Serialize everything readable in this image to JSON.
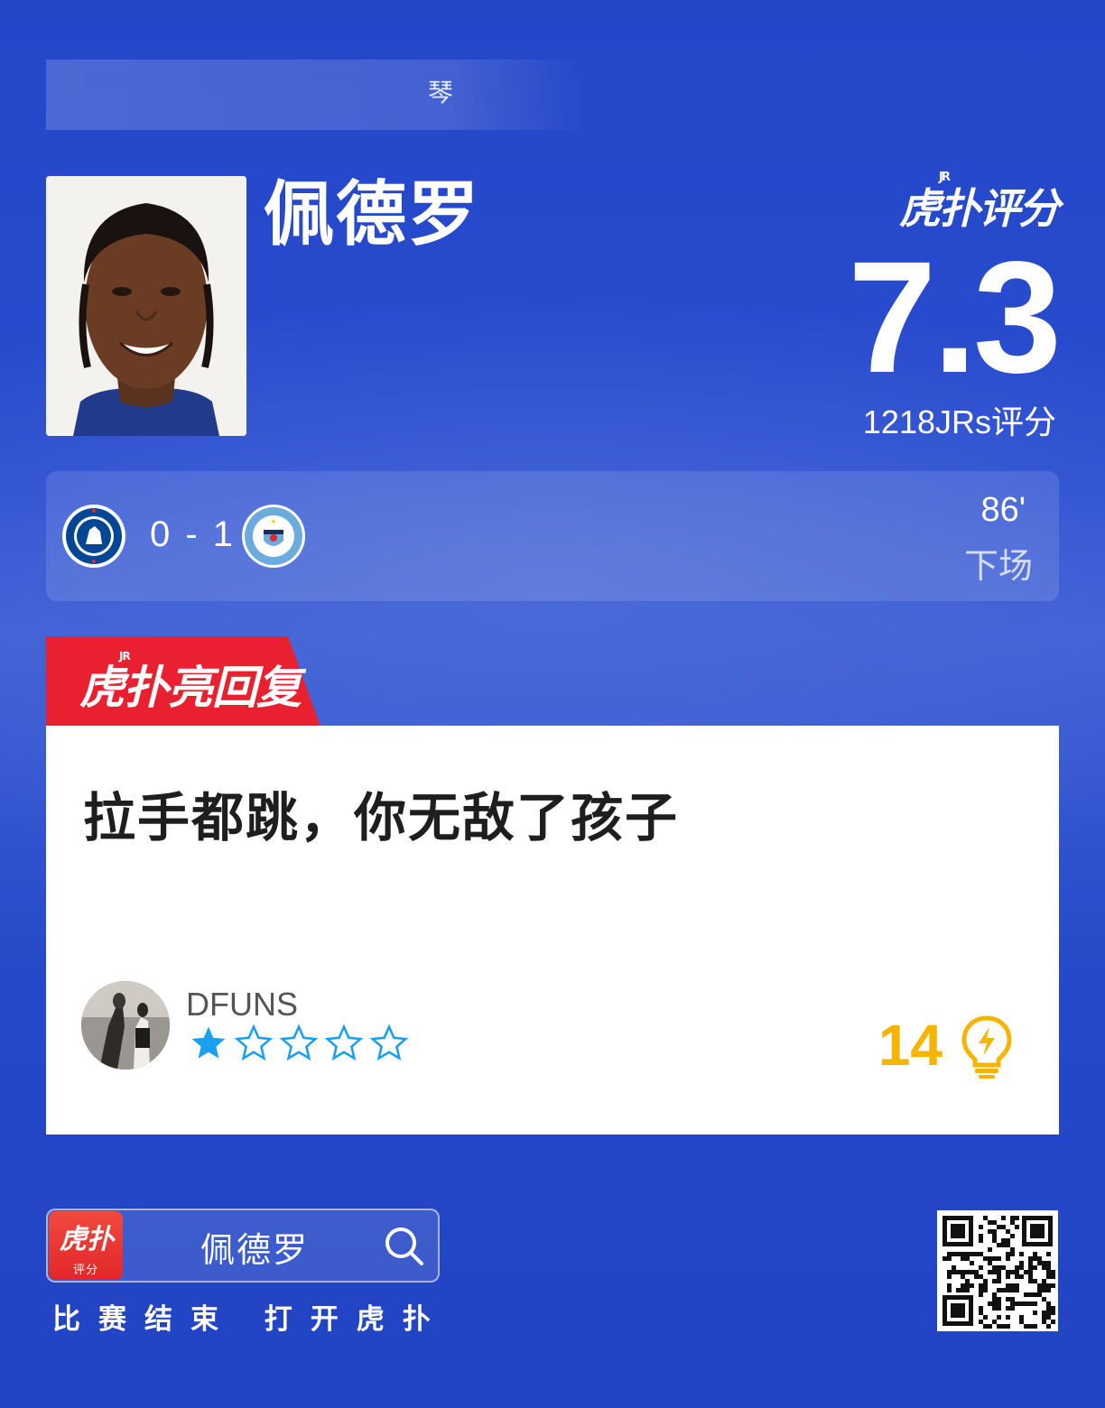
{
  "top_bar": {
    "text": "琴"
  },
  "player": {
    "name": "佩德罗"
  },
  "rating": {
    "brand": "虎扑评分",
    "brand_jr": "JR",
    "score": "7.3",
    "votes": "1218JRs评分"
  },
  "match": {
    "home_team_icon": "chelsea-badge-icon",
    "away_team_icon": "manchester-city-badge-icon",
    "score": "0 - 1",
    "sub_minute": "86'",
    "sub_label": "下场"
  },
  "hot_reply": {
    "tag": "虎扑亮回复",
    "tag_jr": "JR",
    "text": "拉手都跳，你无敌了孩子",
    "username": "DFUNS",
    "stars_filled": 1,
    "stars_total": 5,
    "likes": "14"
  },
  "footer": {
    "app_name": "虎扑",
    "app_sub": "评分",
    "search_text": "佩德罗",
    "tagline": "比赛结束 打开虎扑"
  },
  "colors": {
    "background": "#2446c9",
    "reply_tag": "#e8202f",
    "likes": "#f5b400",
    "star": "#1aa0ee"
  }
}
